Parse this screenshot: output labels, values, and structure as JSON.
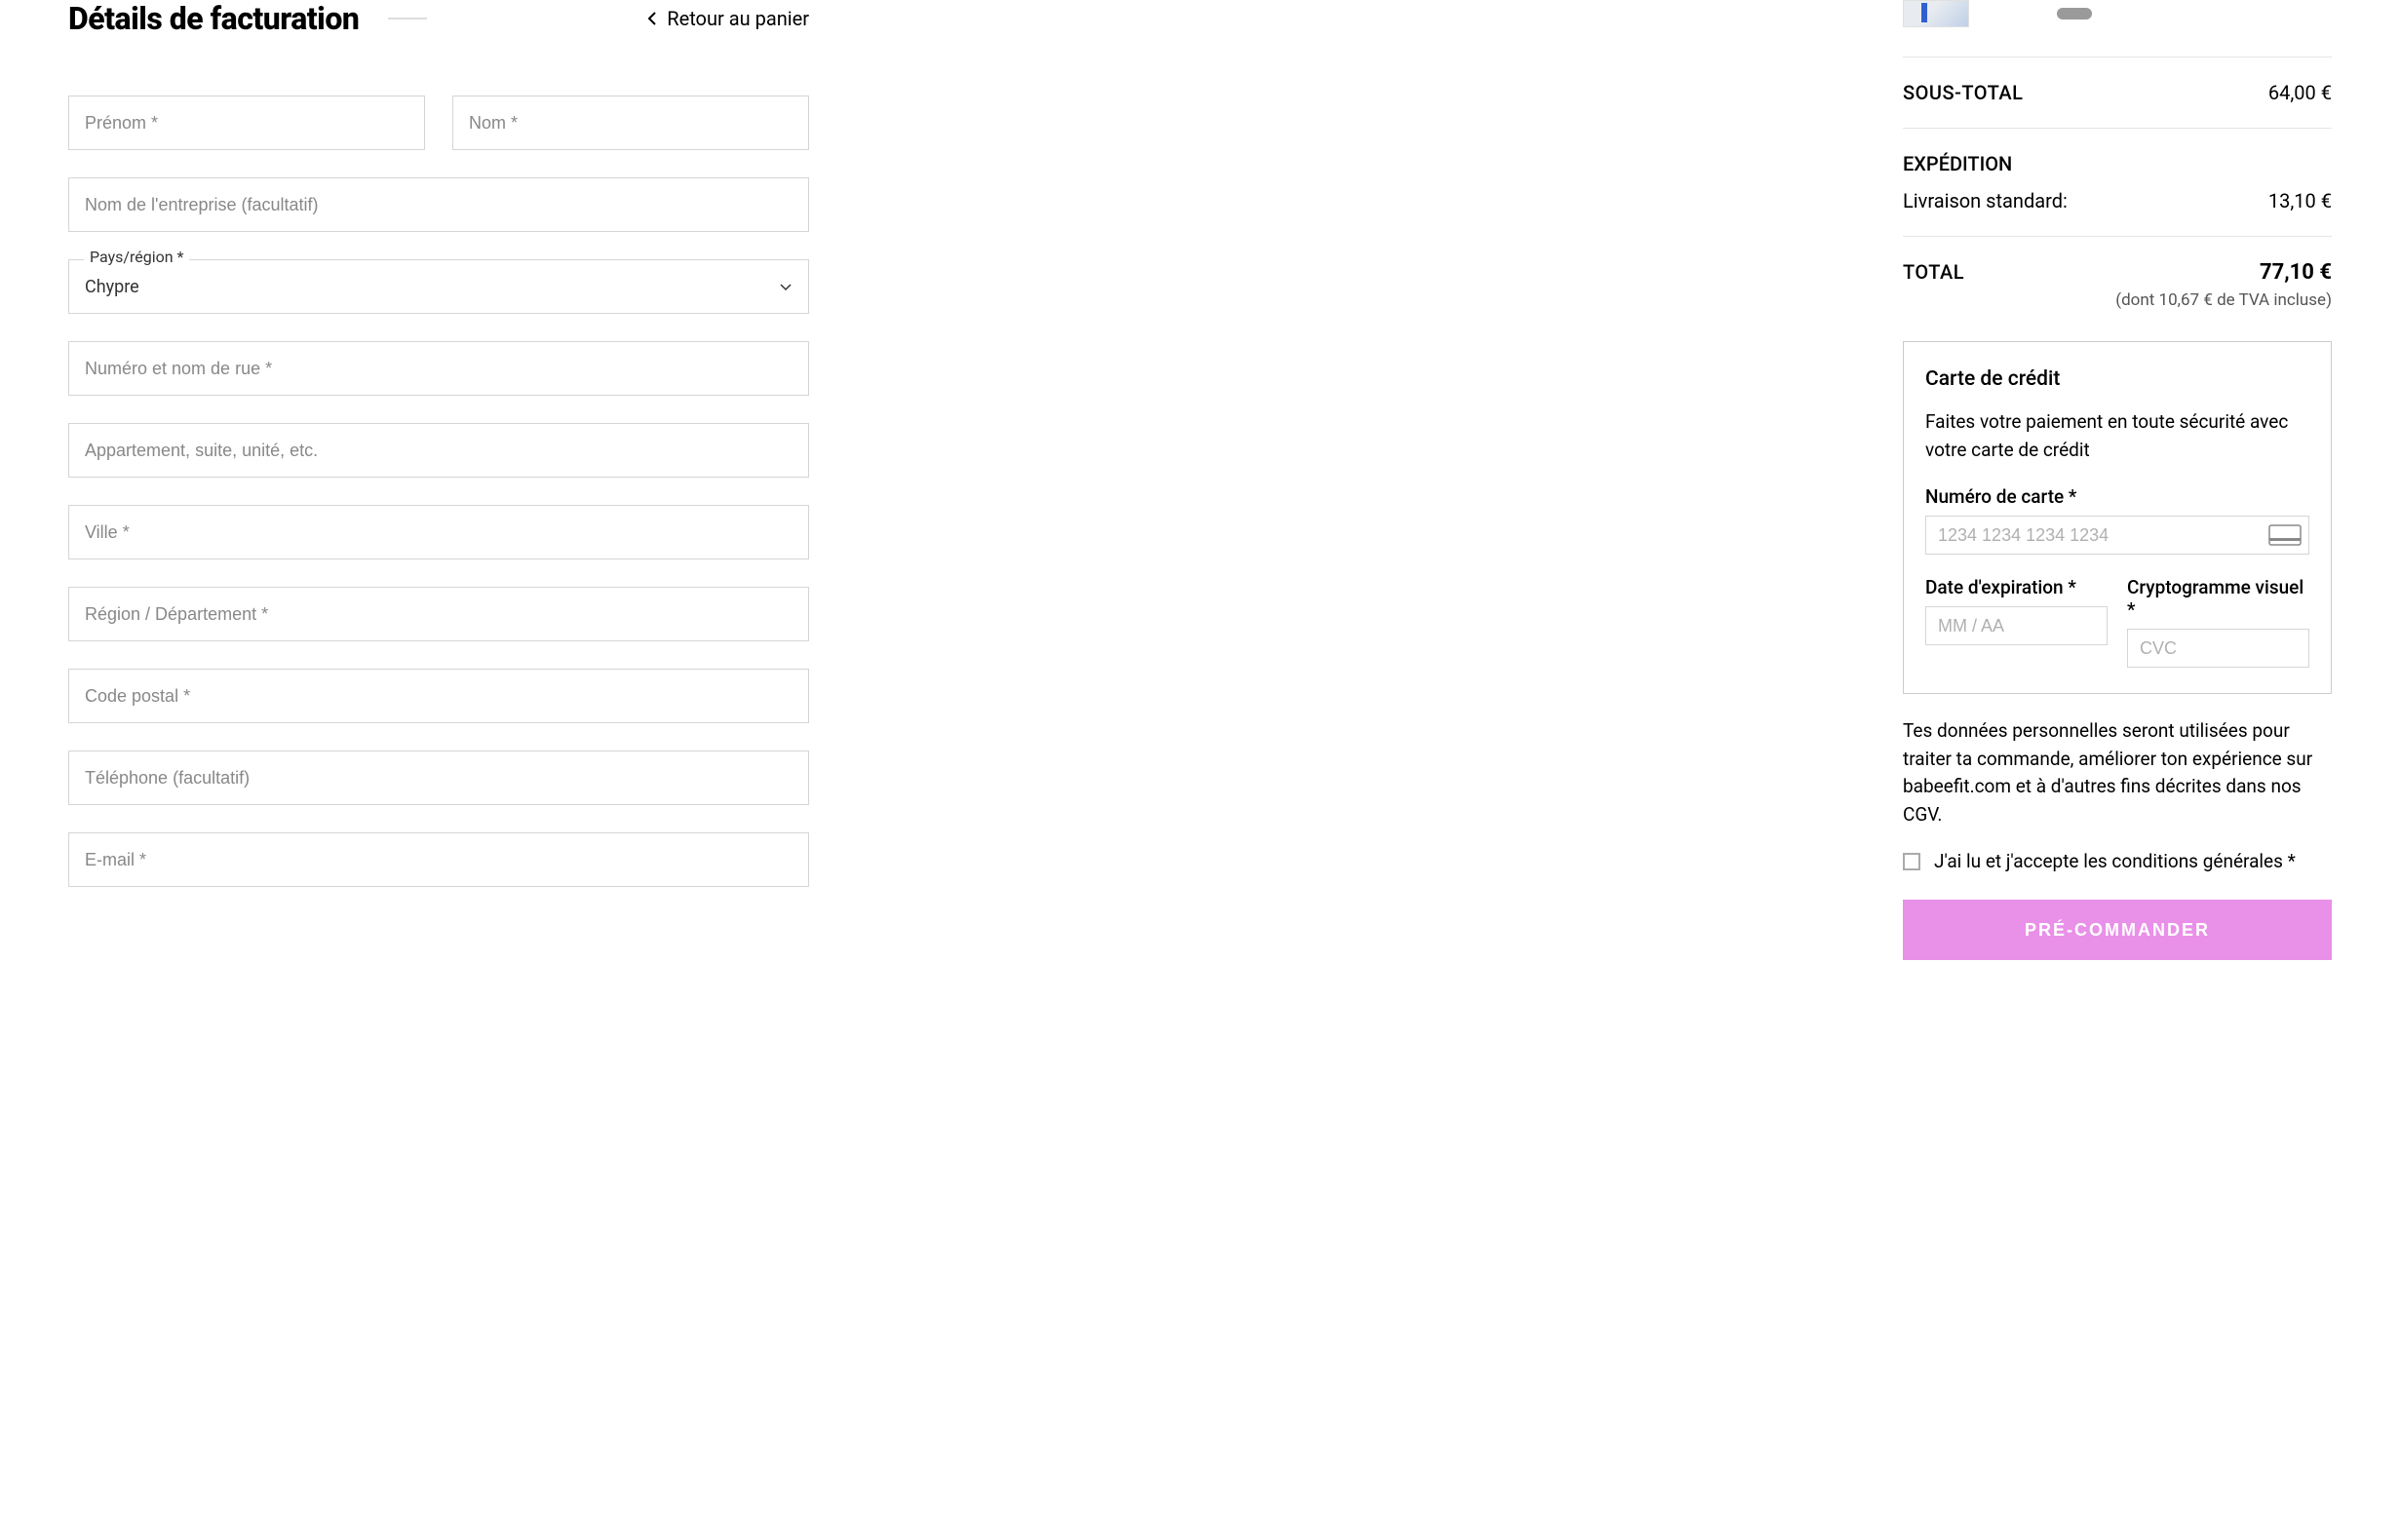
{
  "header": {
    "title": "Détails de facturation",
    "back_label": "Retour au panier"
  },
  "billing": {
    "first_name_ph": "Prénom *",
    "last_name_ph": "Nom *",
    "company_ph": "Nom de l'entreprise (facultatif)",
    "country_label": "Pays/région *",
    "country_value": "Chypre",
    "street_ph": "Numéro et nom de rue *",
    "apt_ph": "Appartement, suite, unité, etc.",
    "city_ph": "Ville *",
    "region_ph": "Région / Département *",
    "postcode_ph": "Code postal *",
    "phone_ph": "Téléphone (facultatif)",
    "email_ph": "E-mail *"
  },
  "summary": {
    "subtotal_label": "SOUS-TOTAL",
    "subtotal_value": "64,00 €",
    "shipping_label": "EXPÉDITION",
    "shipping_method": "Livraison standard:",
    "shipping_value": "13,10 €",
    "total_label": "TOTAL",
    "total_value": "77,10 €",
    "tax_note": "(dont 10,67 € de TVA incluse)"
  },
  "payment": {
    "title": "Carte de crédit",
    "desc": "Faites votre paiement en toute sécurité avec votre carte de crédit",
    "card_number_label": "Numéro de carte *",
    "card_number_ph": "1234 1234 1234 1234",
    "expiry_label": "Date d'expiration *",
    "expiry_ph": "MM / AA",
    "cvc_label": "Cryptogramme visuel *",
    "cvc_ph": "CVC"
  },
  "legal": {
    "privacy": "Tes données personnelles seront utilisées pour traiter ta commande, améliorer ton expérience sur babeefit.com et à d'autres fins décrites dans nos CGV.",
    "terms": "J'ai lu et j'accepte les conditions générales  *"
  },
  "cta": {
    "submit": "PRÉ-COMMANDER"
  }
}
